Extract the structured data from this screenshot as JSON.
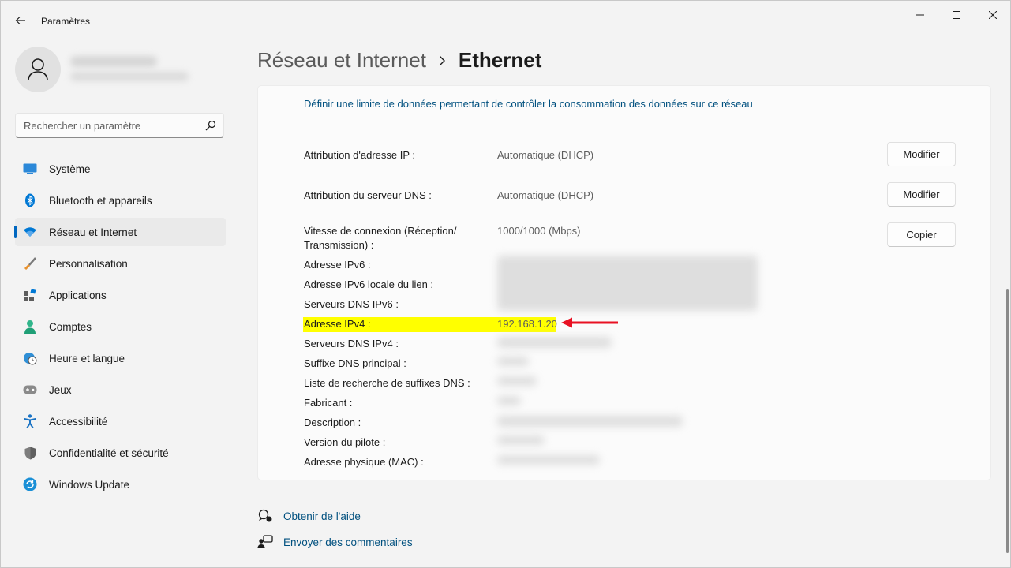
{
  "app": {
    "title": "Paramètres"
  },
  "search": {
    "placeholder": "Rechercher un paramètre"
  },
  "sidebar": {
    "items": [
      {
        "label": "Système",
        "icon": "monitor-icon",
        "active": false
      },
      {
        "label": "Bluetooth et appareils",
        "icon": "bluetooth-icon",
        "active": false
      },
      {
        "label": "Réseau et Internet",
        "icon": "wifi-icon",
        "active": true
      },
      {
        "label": "Personnalisation",
        "icon": "brush-icon",
        "active": false
      },
      {
        "label": "Applications",
        "icon": "apps-icon",
        "active": false
      },
      {
        "label": "Comptes",
        "icon": "person-icon",
        "active": false
      },
      {
        "label": "Heure et langue",
        "icon": "clock-globe-icon",
        "active": false
      },
      {
        "label": "Jeux",
        "icon": "gamepad-icon",
        "active": false
      },
      {
        "label": "Accessibilité",
        "icon": "accessibility-icon",
        "active": false
      },
      {
        "label": "Confidentialité et sécurité",
        "icon": "shield-icon",
        "active": false
      },
      {
        "label": "Windows Update",
        "icon": "update-icon",
        "active": false
      }
    ]
  },
  "breadcrumb": {
    "parent": "Réseau et Internet",
    "current": "Ethernet"
  },
  "card": {
    "data_limit_link": "Définir une limite de données permettant de contrôler la consommation des données sur ce réseau",
    "ip_assignment": {
      "label": "Attribution d'adresse IP :",
      "value": "Automatique (DHCP)",
      "button": "Modifier"
    },
    "dns_assignment": {
      "label": "Attribution du serveur DNS :",
      "value": "Automatique (DHCP)",
      "button": "Modifier"
    },
    "link_speed": {
      "label": "Vitesse de connexion (Réception/ Transmission) :",
      "value": "1000/1000 (Mbps)",
      "button": "Copier"
    },
    "properties": [
      "Adresse IPv6 :",
      "Adresse IPv6 locale du lien :",
      "Serveurs DNS IPv6 :",
      "Adresse IPv4 :",
      "Serveurs DNS IPv4 :",
      "Suffixe DNS principal :",
      "Liste de recherche de suffixes DNS :",
      "Fabricant :",
      "Description :",
      "Version du pilote :",
      "Adresse physique (MAC) :"
    ],
    "ipv4_value": "192.168.1.20",
    "highlight_color": "#ffff00",
    "arrow_color": "#e81123"
  },
  "footer": {
    "help": "Obtenir de l'aide",
    "feedback": "Envoyer des commentaires"
  },
  "colors": {
    "accent": "#0067c0",
    "link": "#00507f"
  }
}
